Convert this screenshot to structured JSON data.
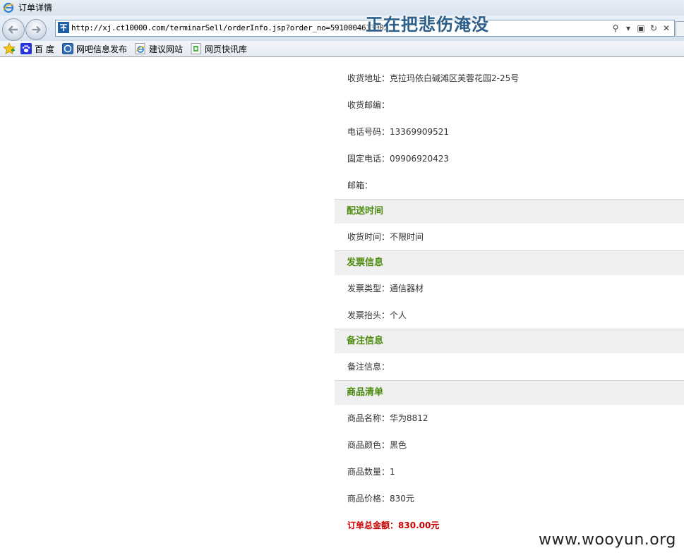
{
  "window": {
    "title": "订单详情"
  },
  "address": {
    "url": "http://xj.ct10000.com/terminarSell/orderInfo.jsp?order_no=5910004613002",
    "overlay": "正在把悲伤淹没"
  },
  "favorites": [
    {
      "label": "百 度",
      "icon": "paw-icon"
    },
    {
      "label": "网吧信息发布",
      "icon": "ie-page-icon"
    },
    {
      "label": "建议网站",
      "icon": "ie-e-icon"
    },
    {
      "label": "网页快讯库",
      "icon": "webslice-icon"
    }
  ],
  "order": {
    "shipping_address": {
      "label": "收货地址：",
      "value": "克拉玛依白碱滩区芙蓉花园2-25号"
    },
    "postal_code": {
      "label": "收货邮编：",
      "value": ""
    },
    "phone": {
      "label": "电话号码：",
      "value": "13369909521"
    },
    "landline": {
      "label": "固定电话：",
      "value": "09906920423"
    },
    "email": {
      "label": "邮箱：",
      "value": ""
    },
    "delivery_section": "配送时间",
    "delivery_time": {
      "label": "收货时间：",
      "value": "不限时间"
    },
    "invoice_section": "发票信息",
    "invoice_type": {
      "label": "发票类型：",
      "value": "通信器材"
    },
    "invoice_title": {
      "label": "发票抬头：",
      "value": "个人"
    },
    "remarks_section": "备注信息",
    "remarks": {
      "label": "备注信息：",
      "value": ""
    },
    "products_section": "商品清单",
    "product_name": {
      "label": "商品名称：",
      "value": "华为8812"
    },
    "product_color": {
      "label": "商品颜色：",
      "value": "黑色"
    },
    "product_qty": {
      "label": "商品数量：",
      "value": "1"
    },
    "product_price": {
      "label": "商品价格：",
      "value": "830元"
    },
    "total": {
      "label": "订单总金额：",
      "value": "830.00元"
    }
  },
  "watermark": "www.wooyun.org",
  "colors": {
    "section_title": "#4d8b10",
    "total": "#cc0000",
    "section_bg": "#f0f0f0"
  }
}
